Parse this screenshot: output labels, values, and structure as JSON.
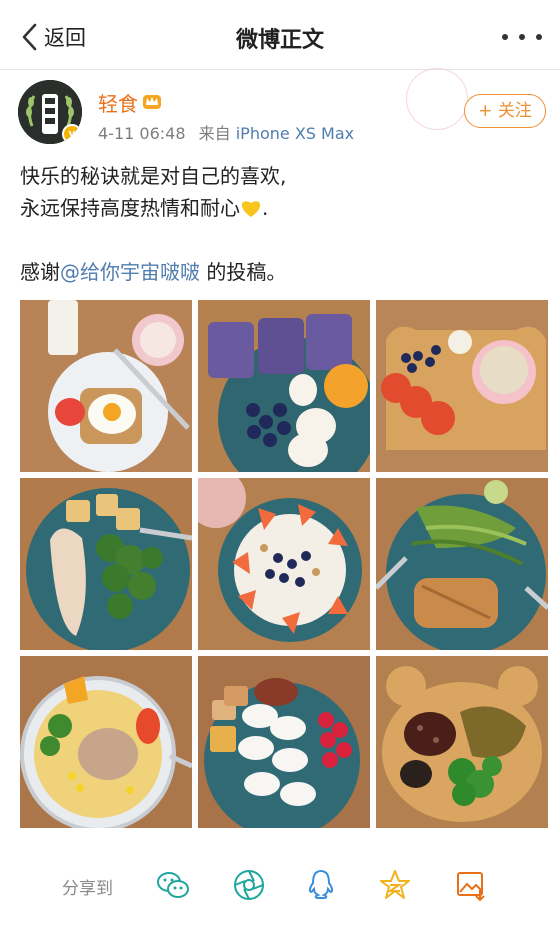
{
  "nav": {
    "back_label": "返回",
    "title": "微博正文"
  },
  "author": {
    "name": "轻食",
    "time": "4-11 06:48",
    "from": "来自",
    "device": "iPhone XS Max"
  },
  "follow_label": "+ 关注",
  "post": {
    "line1": "快乐的秘诀就是对自己的喜欢,",
    "line2_prefix": "永远保持高度热情和耐心",
    "line2_suffix": ".",
    "thanks_prefix": "感谢",
    "mention": "@给你宇宙啵啵",
    "thanks_suffix": " 的投稿。"
  },
  "share": {
    "label": "分享到"
  },
  "colors": {
    "orange": "#e8701a",
    "link": "#507daf",
    "follow": "#ee8f33",
    "icon": "#1ea69c"
  }
}
